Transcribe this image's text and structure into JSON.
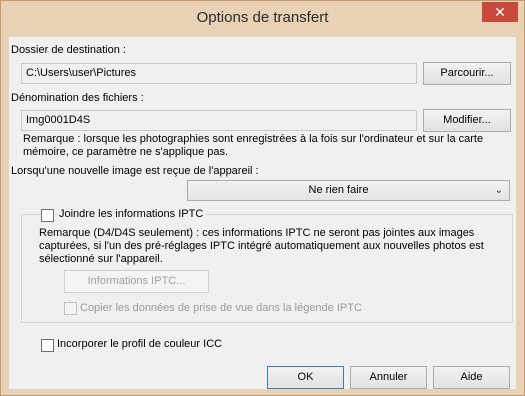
{
  "window": {
    "title": "Options de transfert",
    "close_symbol": "✕"
  },
  "destination": {
    "label": "Dossier de destination :",
    "path": "C:\\Users\\user\\Pictures",
    "browse_label": "Parcourir..."
  },
  "naming": {
    "label": "Dénomination des fichiers :",
    "value": "Img0001D4S",
    "modify_label": "Modifier...",
    "note_line1": "Remarque : lorsque les photographies sont enregistrées à la fois sur l'ordinateur et sur la carte",
    "note_line2": "mémoire, ce paramètre ne s'applique pas."
  },
  "new_image": {
    "label": "Lorsqu'une nouvelle image est reçue de l'appareil :",
    "selected": "Ne rien faire"
  },
  "iptc": {
    "checkbox_label": "Joindre les informations IPTC",
    "checked": false,
    "note_line1": "Remarque (D4/D4S seulement) : ces informations IPTC ne seront pas jointes aux images",
    "note_line2": "capturées, si l'un des pré-réglages IPTC intégré automatiquement aux nouvelles photos est",
    "note_line3": "sélectionné sur l'appareil.",
    "info_button_label": "Informations IPTC...",
    "copy_label": "Copier les données de prise de vue dans la légende IPTC",
    "copy_checked": false
  },
  "icc": {
    "label": "Incorporer le profil de couleur ICC",
    "checked": false
  },
  "buttons": {
    "ok": "OK",
    "cancel": "Annuler",
    "help": "Aide"
  }
}
